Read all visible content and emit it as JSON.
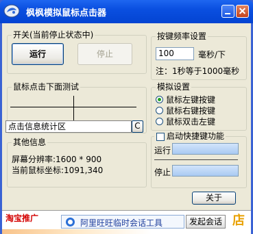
{
  "window": {
    "title": "枫枫模拟鼠标点击器"
  },
  "switch_group": {
    "legend": "开关(当前停止状态中)",
    "run_label": "运行",
    "stop_label": "停止"
  },
  "frequency_group": {
    "legend": "按键频率设置",
    "value": "100",
    "unit": "毫秒/下",
    "note": "注：1秒等于1000毫秒"
  },
  "test_group": {
    "legend": "鼠标点击下面测试",
    "stats_text": "点击信息统计区",
    "clear_label": "C"
  },
  "mode_group": {
    "legend": "模拟设置",
    "options": [
      "鼠标左键按键",
      "鼠标右键按键",
      "鼠标双击左键"
    ],
    "selected_index": 0
  },
  "hotkey_group": {
    "legend": "启动快捷键功能",
    "checked": false,
    "run_label": "运行",
    "stop_label": "停止"
  },
  "info_group": {
    "legend": "其他信息",
    "resolution": "屏幕分辨率:1600 * 900",
    "mouse_coord": "当前鼠标坐标:1091,340"
  },
  "about_label": "关于",
  "ad": {
    "brand": "淘宝推广",
    "chat_text": "阿里旺旺临时会话工具",
    "chat_button": "发起会话",
    "shop_glyph": "店"
  },
  "colors": {
    "titlebar": "#0a4fe0",
    "client_bg": "#ece9d8",
    "radio_on": "#21a121",
    "hotkey_field": "#a9caf2",
    "ad_brand": "#d30000"
  }
}
